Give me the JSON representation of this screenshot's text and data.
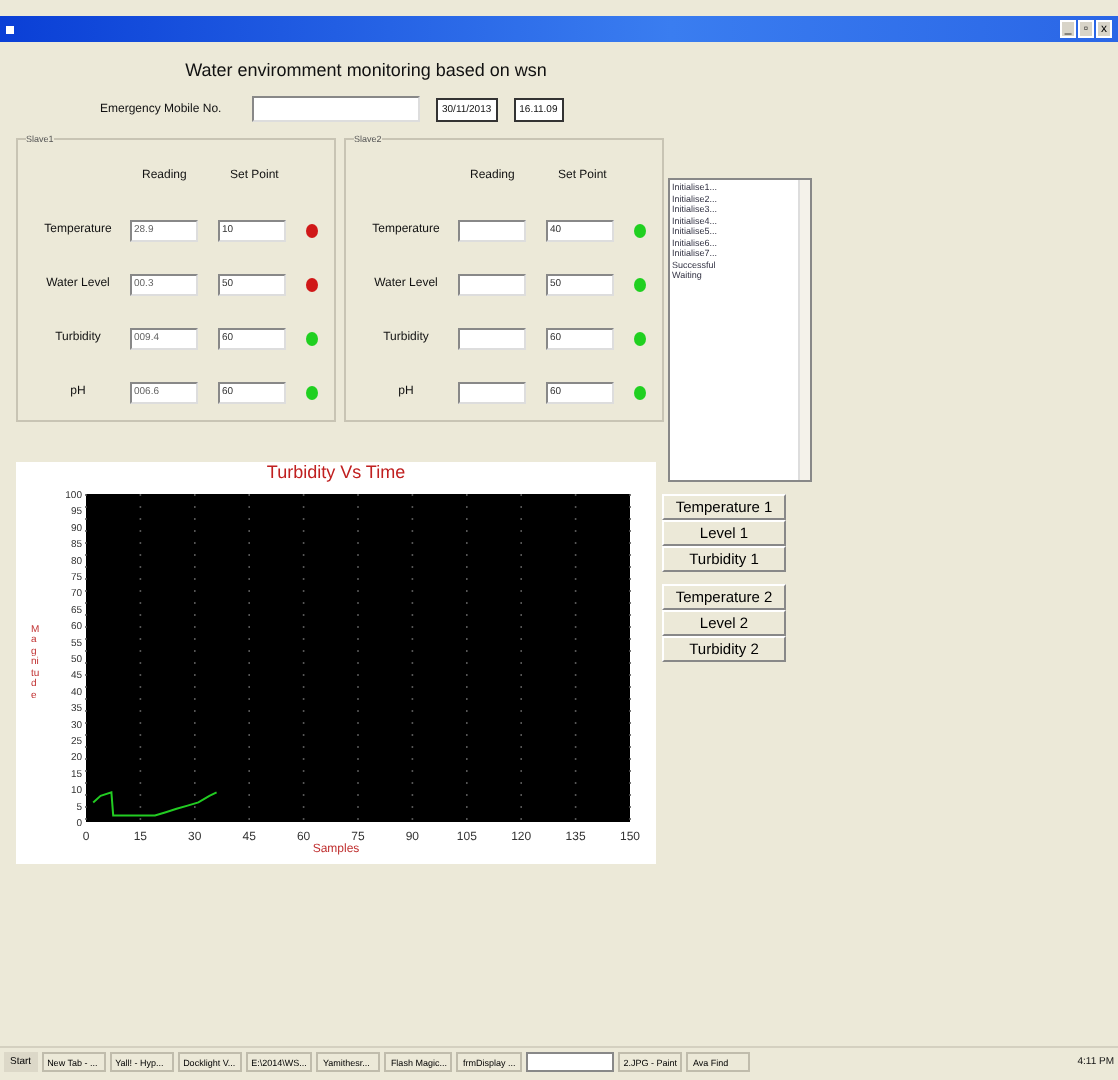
{
  "title_bar": {
    "buttons": [
      "_",
      "▫",
      "x"
    ]
  },
  "heading": "Water enviromment monitoring based on wsn",
  "emergency": {
    "label": "Emergency Mobile No.",
    "date": "30/11/2013",
    "time": "16.11.09"
  },
  "slaves": [
    {
      "title": "Slave1",
      "columns": [
        "Reading",
        "Set Point"
      ],
      "rows": [
        {
          "label": "Temperature",
          "reading": "28.9",
          "set_point": "10",
          "alarm": true
        },
        {
          "label": "Water Level",
          "reading": "00.3",
          "set_point": "50",
          "alarm": true
        },
        {
          "label": "Turbidity",
          "reading": "009.4",
          "set_point": "60",
          "alarm": false
        },
        {
          "label": "pH",
          "reading": "006.6",
          "set_point": "60",
          "alarm": false
        }
      ]
    },
    {
      "title": "Slave2",
      "columns": [
        "Reading",
        "Set Point"
      ],
      "rows": [
        {
          "label": "Temperature",
          "reading": "",
          "set_point": "40",
          "alarm": false
        },
        {
          "label": "Water Level",
          "reading": "",
          "set_point": "50",
          "alarm": false
        },
        {
          "label": "Turbidity",
          "reading": "",
          "set_point": "60",
          "alarm": false
        },
        {
          "label": "pH",
          "reading": "",
          "set_point": "60",
          "alarm": false
        }
      ]
    }
  ],
  "log": [
    "Initialise1...",
    "Initialise2...",
    "Initialise3...",
    "Initialise4...",
    "Initialise5...",
    "Initialise6...",
    "Initialise7...",
    "Successful",
    "Waiting"
  ],
  "chart": {
    "chart_data": {
      "type": "line",
      "title": "Turbidity Vs Time",
      "xlabel": "Samples",
      "ylabel": "Magnitude",
      "x": [
        2,
        4,
        7,
        7.5,
        8,
        12,
        16,
        19,
        22,
        25,
        28,
        31,
        34,
        36
      ],
      "grid": true,
      "series": [
        {
          "color": "#22cc22",
          "values": [
            6,
            8,
            9,
            2,
            2,
            2,
            2,
            2,
            3,
            4,
            5,
            6,
            8,
            9
          ]
        }
      ],
      "xlim": [
        0,
        150
      ],
      "ylim": [
        0,
        100
      ],
      "xticks": [
        0,
        15,
        30,
        45,
        60,
        75,
        90,
        105,
        120,
        135,
        {
          "value": 150,
          "label": "150"
        }
      ],
      "yticks": [
        0,
        5,
        10,
        15,
        20,
        25,
        30,
        35,
        40,
        45,
        50,
        55,
        60,
        65,
        70,
        75,
        80,
        85,
        90,
        95,
        100
      ]
    }
  },
  "button_groups": [
    [
      "Temperature 1",
      "Level 1",
      "Turbidity 1"
    ],
    [
      "Temperature 2",
      "Level 2",
      "Turbidity 2"
    ]
  ],
  "taskbar": {
    "start": "Start",
    "tasks": [
      {
        "label": "New Tab - ...",
        "selected": false
      },
      {
        "label": "Yall! - Hyp...",
        "selected": false
      },
      {
        "label": "Docklight V...",
        "selected": false
      },
      {
        "label": "E:\\2014\\WS...",
        "selected": false
      },
      {
        "label": "Yamithesr...",
        "selected": false
      },
      {
        "label": "Flash Magic...",
        "selected": false
      },
      {
        "label": "frmDisplay ...",
        "selected": false
      },
      {
        "selected": true
      },
      {
        "label": "2.JPG - Paint",
        "selected": false
      },
      {
        "label": "Ava Find",
        "selected": false
      }
    ],
    "clock": "4:11 PM"
  }
}
